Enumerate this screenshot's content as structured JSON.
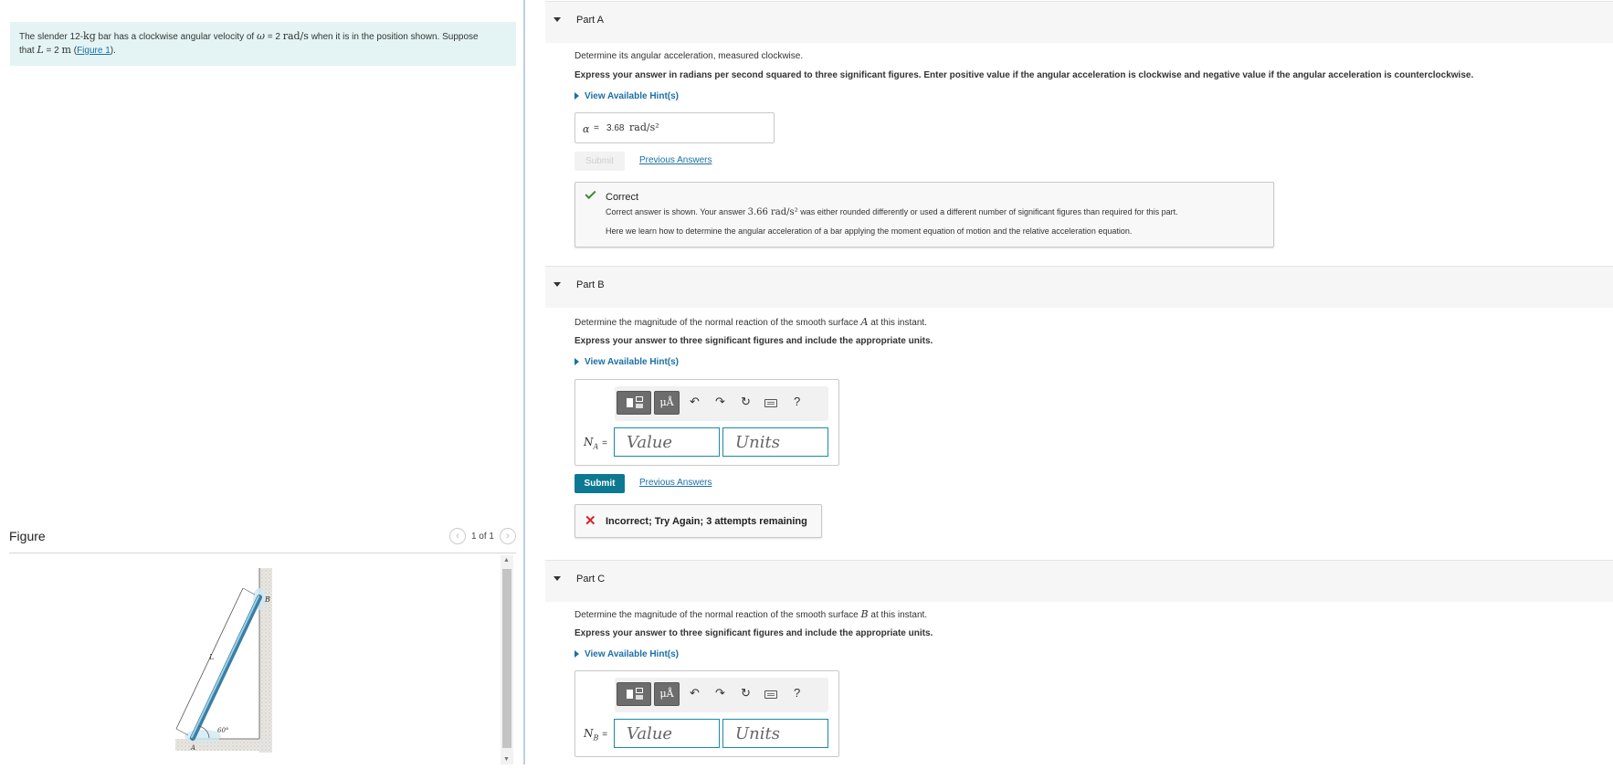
{
  "problem": {
    "text_before": "The slender 12-",
    "mass_unit": "kg",
    "text_mid": " bar has a clockwise angular velocity of ",
    "omega_symbol": "ω",
    "omega_value": " = 2 ",
    "omega_unit": "rad/s",
    "text_after": " when it is in the position shown. Suppose",
    "line2_prefix": "that ",
    "L_symbol": "L",
    "L_value": " = 2 ",
    "L_unit": "m",
    "figure_link": "Figure 1",
    "line2_suffix": ")."
  },
  "figure": {
    "title": "Figure",
    "pager_text": "1 of 1",
    "labels": {
      "B": "B",
      "L": "L",
      "angle": "60°",
      "A": "A"
    }
  },
  "partA": {
    "title": "Part A",
    "question": "Determine its angular acceleration, measured clockwise.",
    "instruction": "Express your answer in radians per second squared to three significant figures. Enter positive value if the angular acceleration is clockwise and negative value if the angular acceleration is counterclockwise.",
    "hint_label": "View Available Hint(s)",
    "answer_symbol": "α",
    "answer_eq": "=",
    "answer_value": "3.68",
    "answer_unit": "rad/s²",
    "submit_label": "Submit",
    "previous_answers": "Previous Answers",
    "feedback": {
      "heading": "Correct",
      "line1_before": "Correct answer is shown. Your answer ",
      "line1_value": "3.66 rad/s²",
      "line1_after": " was either rounded differently or used a different number of significant figures than required for this part.",
      "line2": "Here we learn how to determine the angular acceleration of a bar applying the moment equation of motion and the relative acceleration equation."
    }
  },
  "partB": {
    "title": "Part B",
    "question_before": "Determine the magnitude of the normal reaction of the smooth surface ",
    "question_symbol": "A",
    "question_after": " at this instant.",
    "instruction": "Express your answer to three significant figures and include the appropriate units.",
    "hint_label": "View Available Hint(s)",
    "var_symbol": "N",
    "var_sub": "A",
    "var_eq": "=",
    "value_placeholder": "Value",
    "units_placeholder": "Units",
    "submit_label": "Submit",
    "previous_answers": "Previous Answers",
    "feedback": {
      "icon": "✕",
      "heading": "Incorrect; Try Again; 3 attempts remaining"
    }
  },
  "partC": {
    "title": "Part C",
    "question_before": "Determine the magnitude of the normal reaction of the smooth surface ",
    "question_symbol": "B",
    "question_after": " at this instant.",
    "instruction": "Express your answer to three significant figures and include the appropriate units.",
    "hint_label": "View Available Hint(s)",
    "var_symbol": "N",
    "var_sub": "B",
    "var_eq": "=",
    "value_placeholder": "Value",
    "units_placeholder": "Units"
  },
  "toolbar": {
    "templates_icon": "templates-icon",
    "units_symbol": "μÅ",
    "undo_icon": "↶",
    "redo_icon": "↷",
    "reset_icon": "↻",
    "help": "?"
  },
  "colors": {
    "accent": "#0d7891",
    "link": "#1a6fa5",
    "correct": "#3a8a2c",
    "incorrect": "#d4252b",
    "problem_bg": "#e4f4f4"
  }
}
